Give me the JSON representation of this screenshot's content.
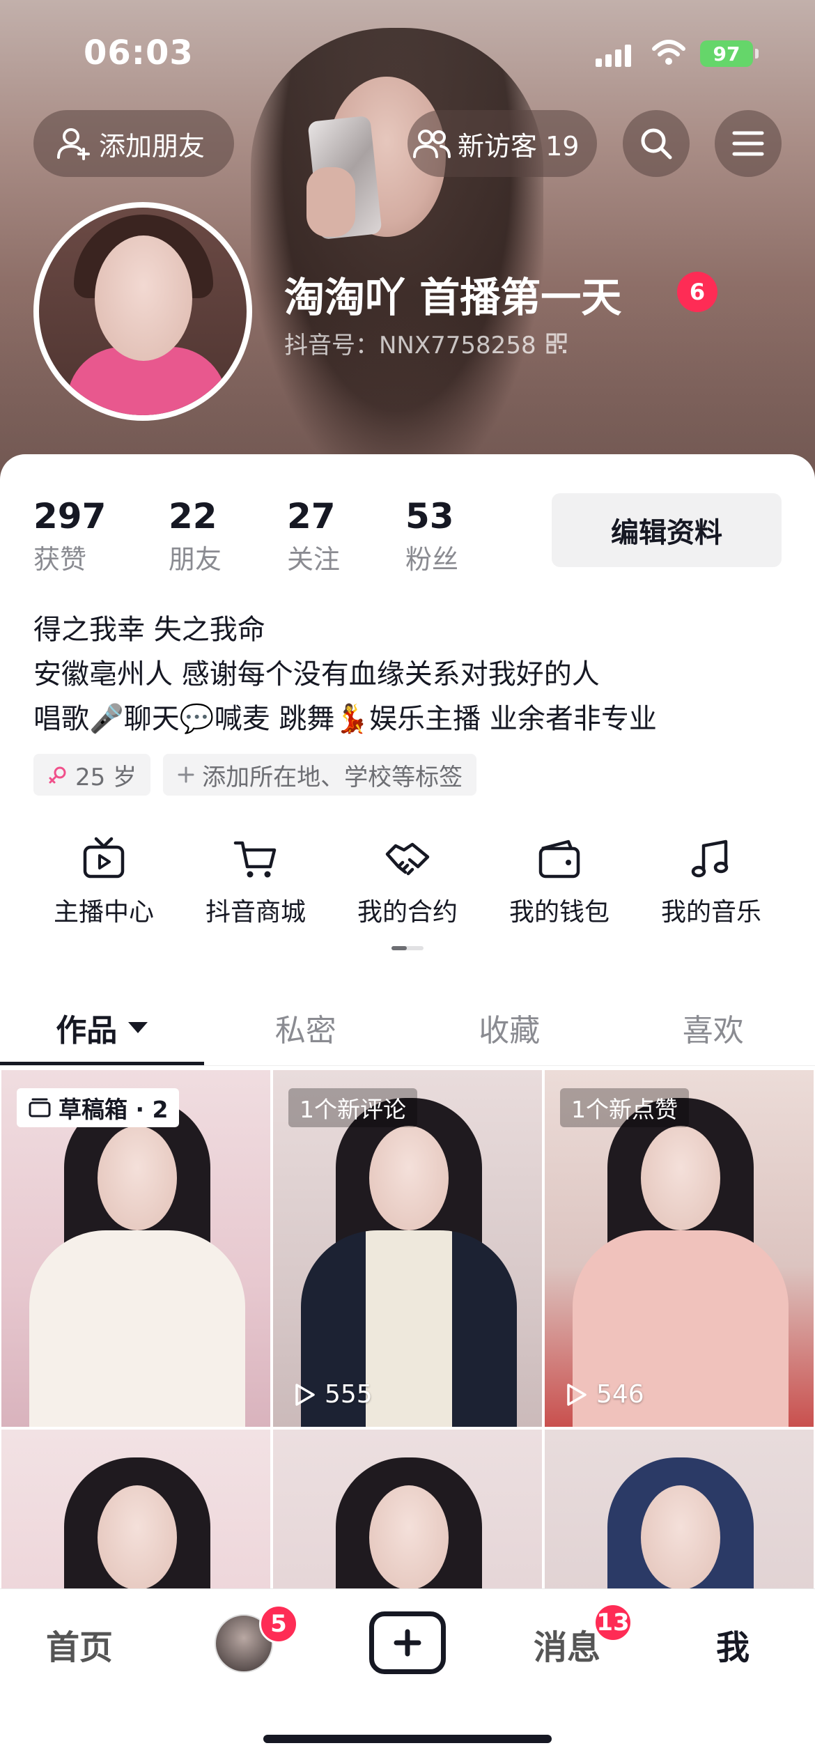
{
  "status_bar": {
    "time": "06:03",
    "battery": "97"
  },
  "header": {
    "add_friend_label": "添加朋友",
    "visitors_label": "新访客 19",
    "search_icon": "search-icon",
    "menu_icon": "menu-icon"
  },
  "profile": {
    "nickname": "淘淘吖 首播第一天",
    "level_badge": "6",
    "douyin_id": "抖音号：NNX7758258",
    "stats": [
      {
        "value": "297",
        "label": "获赞"
      },
      {
        "value": "22",
        "label": "朋友"
      },
      {
        "value": "27",
        "label": "关注"
      },
      {
        "value": "53",
        "label": "粉丝"
      }
    ],
    "edit_label": "编辑资料",
    "bio": [
      "得之我幸 失之我命",
      "安徽亳州人 感谢每个没有血缘关系对我好的人",
      "唱歌🎤聊天💬喊麦 跳舞💃娱乐主播 业余者非专业"
    ],
    "tags": [
      {
        "icon": "female-icon",
        "text": "25 岁"
      },
      {
        "icon": "plus-icon",
        "text": "添加所在地、学校等标签"
      }
    ]
  },
  "shortcuts": [
    {
      "icon": "tv-icon",
      "label": "主播中心"
    },
    {
      "icon": "cart-icon",
      "label": "抖音商城"
    },
    {
      "icon": "handshake-icon",
      "label": "我的合约"
    },
    {
      "icon": "wallet-icon",
      "label": "我的钱包"
    },
    {
      "icon": "music-note-icon",
      "label": "我的音乐"
    }
  ],
  "tabs": [
    {
      "label": "作品",
      "active": true
    },
    {
      "label": "私密",
      "active": false
    },
    {
      "label": "收藏",
      "active": false
    },
    {
      "label": "喜欢",
      "active": false
    }
  ],
  "videos": [
    {
      "badge": "草稿箱 · 2",
      "badge_type": "draft",
      "plays": ""
    },
    {
      "badge": "1个新评论",
      "badge_type": "new",
      "plays": "555"
    },
    {
      "badge": "1个新点赞",
      "badge_type": "new",
      "plays": "546"
    },
    {
      "badge": "",
      "badge_type": "",
      "plays": ""
    },
    {
      "badge": "",
      "badge_type": "",
      "plays": ""
    },
    {
      "badge": "",
      "badge_type": "",
      "plays": ""
    }
  ],
  "bottom_nav": {
    "home": "首页",
    "friends_badge": "5",
    "messages": "消息",
    "messages_badge": "13",
    "me": "我"
  },
  "colors": {
    "accent": "#fe2c55",
    "text": "#161823",
    "muted": "#8a8b91"
  }
}
